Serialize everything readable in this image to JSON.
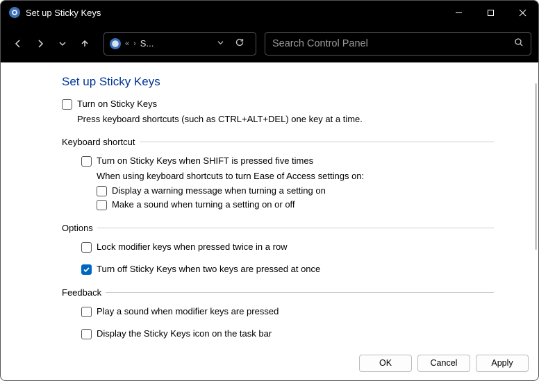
{
  "titlebar": {
    "title": "Set up Sticky Keys"
  },
  "toolbar": {
    "breadcrumb_trunc": "S...",
    "search_placeholder": "Search Control Panel"
  },
  "page": {
    "title": "Set up Sticky Keys",
    "turn_on": {
      "label": "Turn on Sticky Keys",
      "checked": false
    },
    "desc": "Press keyboard shortcuts (such as CTRL+ALT+DEL) one key at a time.",
    "groups": {
      "shortcut": {
        "legend": "Keyboard shortcut",
        "shift5": {
          "label": "Turn on Sticky Keys when SHIFT is pressed five times",
          "checked": false
        },
        "subdesc": "When using keyboard shortcuts to turn Ease of Access settings on:",
        "display_warning": {
          "label": "Display a warning message when turning a setting on",
          "checked": false
        },
        "make_sound": {
          "label": "Make a sound when turning a setting on or off",
          "checked": false
        }
      },
      "options": {
        "legend": "Options",
        "lock_modifier": {
          "label": "Lock modifier keys when pressed twice in a row",
          "checked": false
        },
        "turn_off_two": {
          "label": "Turn off Sticky Keys when two keys are pressed at once",
          "checked": true
        }
      },
      "feedback": {
        "legend": "Feedback",
        "play_sound": {
          "label": "Play a sound when modifier keys are pressed",
          "checked": false
        },
        "display_icon": {
          "label": "Display the Sticky Keys icon on the task bar",
          "checked": false
        }
      }
    }
  },
  "footer": {
    "ok": "OK",
    "cancel": "Cancel",
    "apply": "Apply"
  }
}
